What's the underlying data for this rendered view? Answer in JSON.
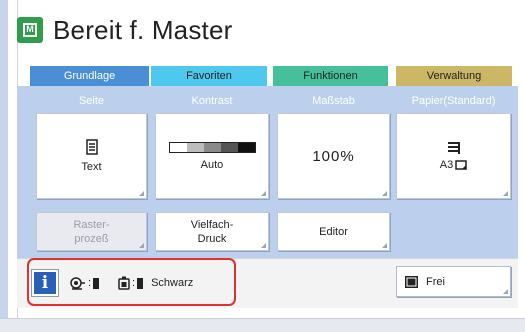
{
  "header": {
    "title": "Bereit f. Master",
    "icon": "master-icon"
  },
  "tabs": [
    {
      "label": "Grundlage",
      "color": "#4a8fd6",
      "active": true
    },
    {
      "label": "Favoriten",
      "color": "#4fc8ee"
    },
    {
      "label": "Funktionen",
      "color": "#45c09a"
    },
    {
      "label": "Verwaltung",
      "color": "#cbb766"
    }
  ],
  "columns": {
    "seite": "Seite",
    "kontrast": "Kontrast",
    "massstab": "Maßstab",
    "papier": "Papier(Standard)"
  },
  "tiles": {
    "seite": {
      "value": "Text",
      "icon": "document-icon"
    },
    "kontrast": {
      "value": "Auto",
      "icon": "contrast-scale-icon"
    },
    "massstab": {
      "value": "100%"
    },
    "papier": {
      "value": "A3",
      "icon": "paper-stack-icon"
    }
  },
  "functions": {
    "rasterprozess": "Raster-\nprozeß",
    "vielfachdruck": "Vielfach-\nDruck",
    "editor": "Editor"
  },
  "status": {
    "color_label": "Schwarz",
    "master_sep": ":",
    "ink_sep": ":"
  },
  "frei_button": {
    "label": "Frei",
    "icon": "screen-icon"
  },
  "colors": {
    "panel": "#bcd0ee",
    "info_button": "#2a5fb8",
    "highlight": "#e03030",
    "master_icon": "#2e9e4a"
  }
}
